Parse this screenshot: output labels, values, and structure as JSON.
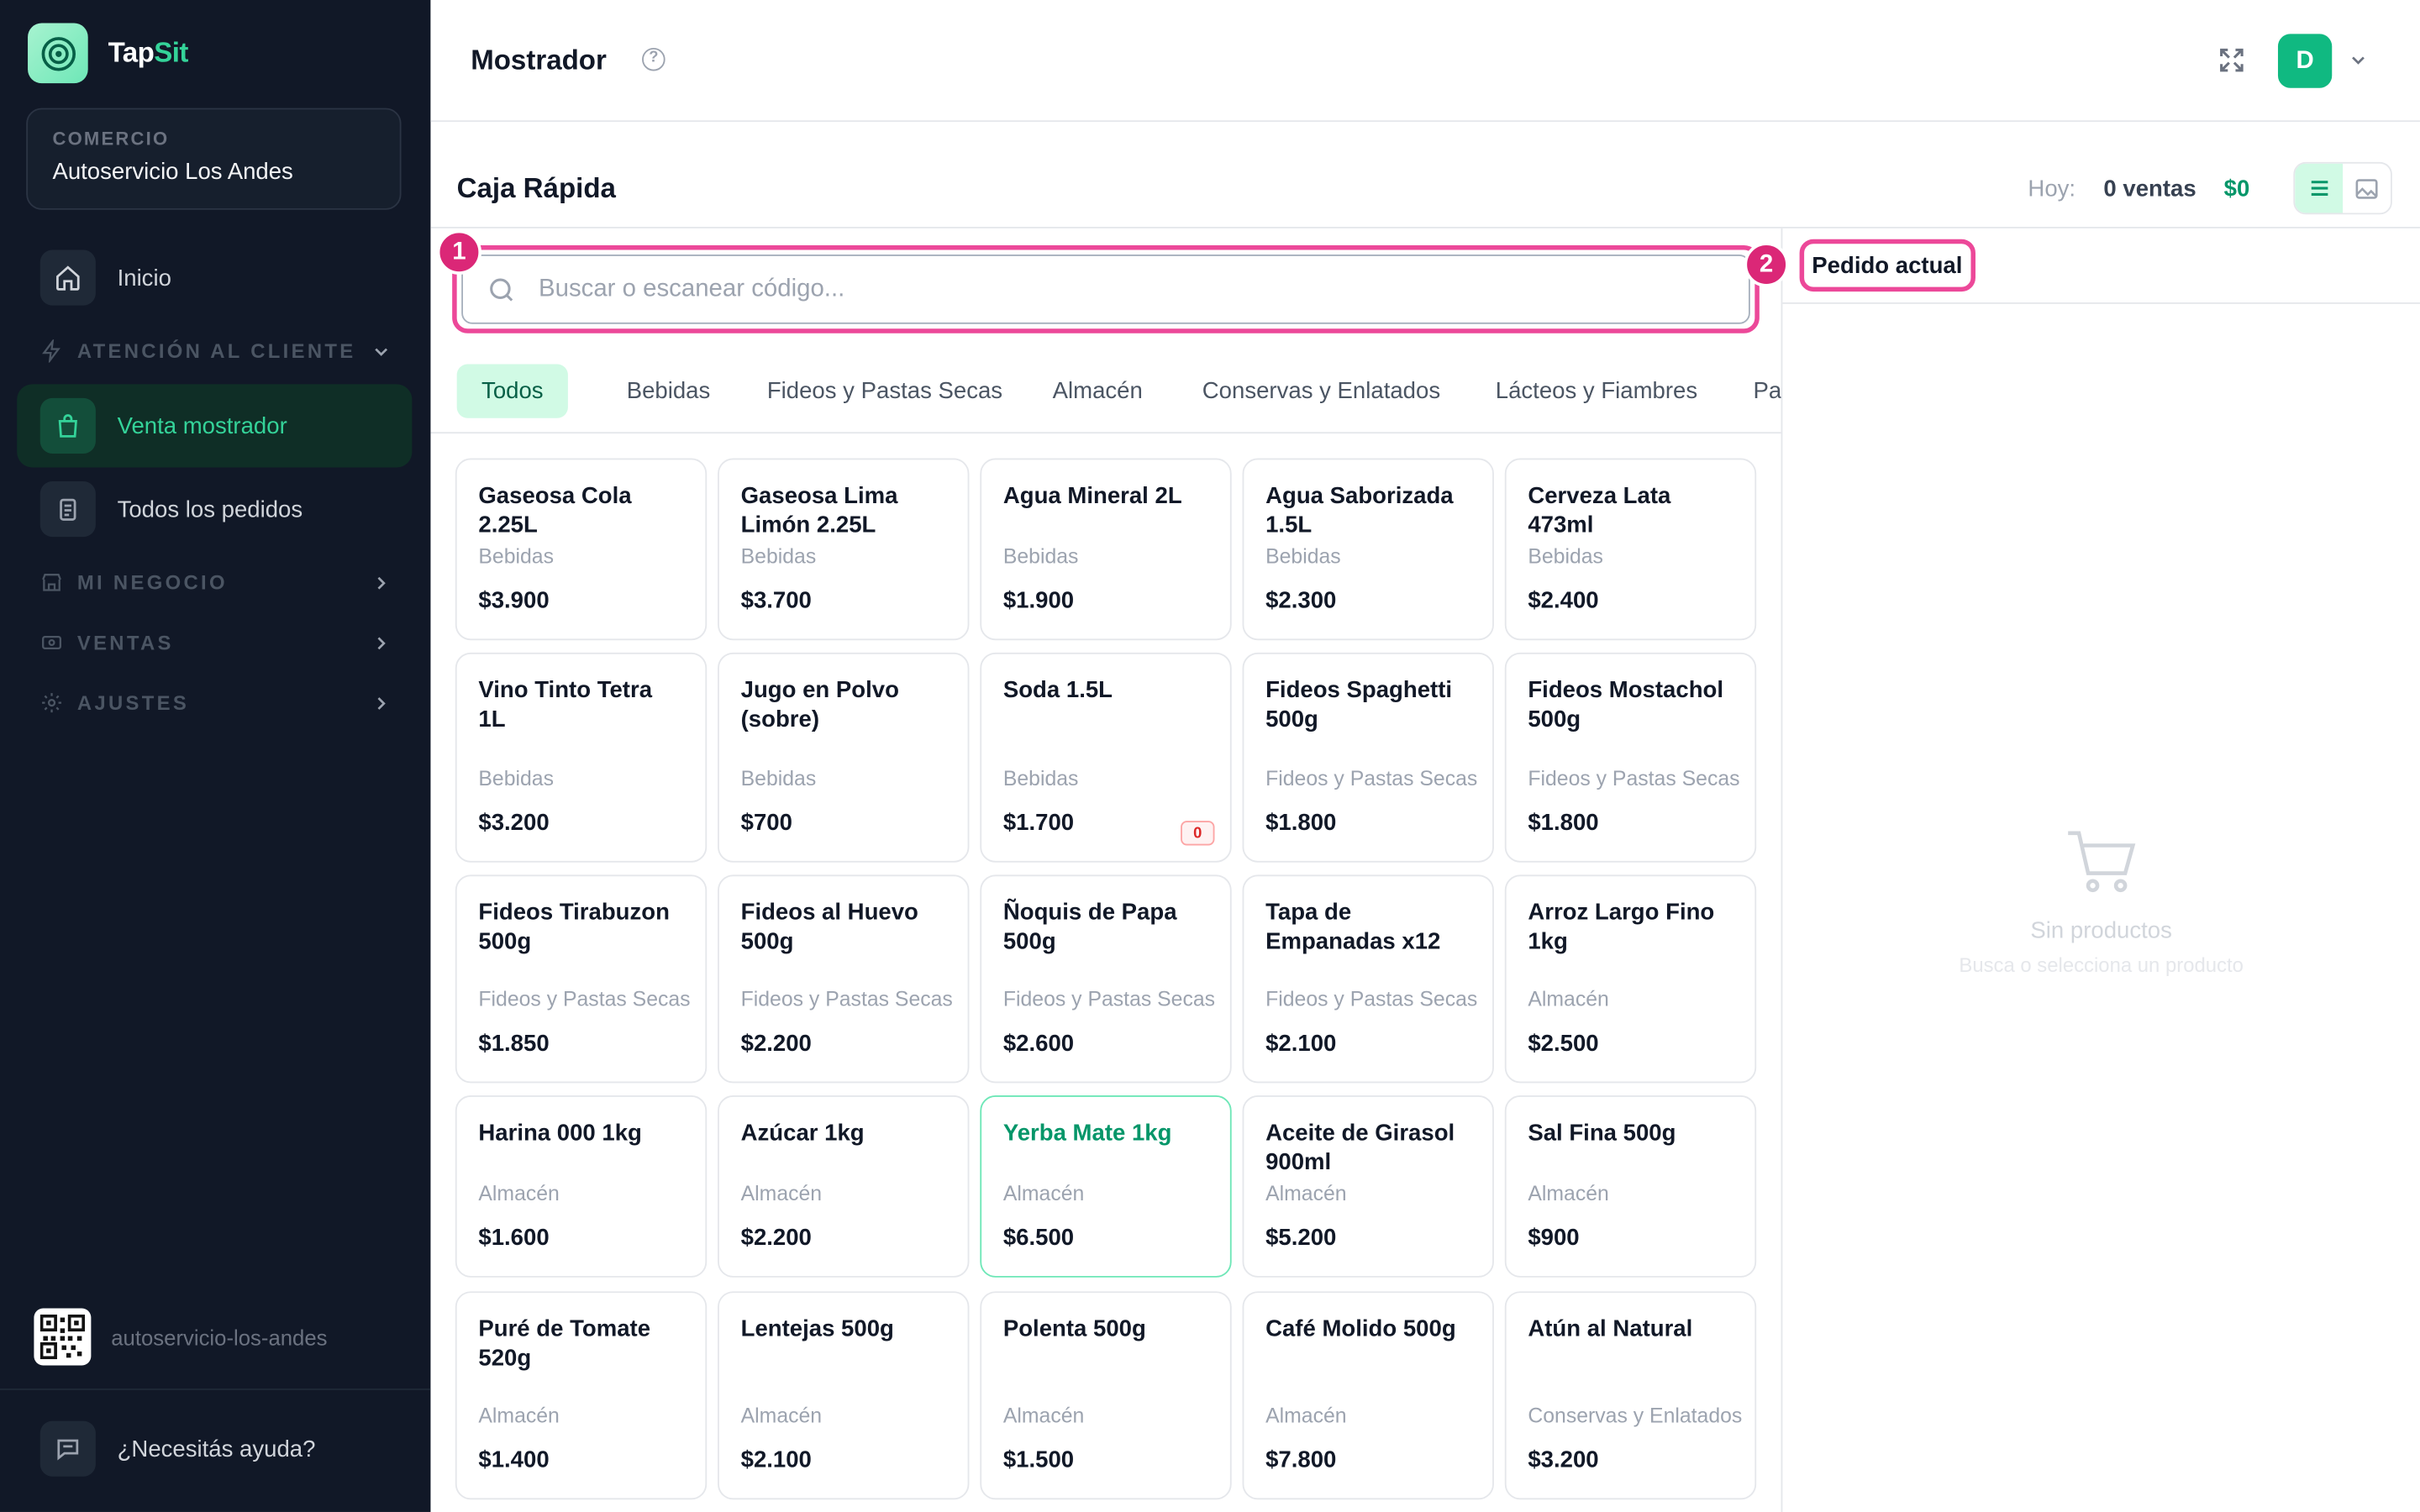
{
  "brand": {
    "name_main": "Tap",
    "name_accent": "Sit"
  },
  "store": {
    "label": "COMERCIO",
    "name": "Autoservicio Los Andes"
  },
  "sidebar": {
    "home": "Inicio",
    "sections": [
      {
        "label": "ATENCIÓN AL CLIENTE",
        "icon": "bolt-icon",
        "expanded": true
      },
      {
        "label": "MI NEGOCIO",
        "icon": "store-icon",
        "expanded": false
      },
      {
        "label": "VENTAS",
        "icon": "cash-icon",
        "expanded": false
      },
      {
        "label": "AJUSTES",
        "icon": "gear-icon",
        "expanded": false
      }
    ],
    "items": [
      {
        "label": "Venta mostrador",
        "icon": "shopping-bag-icon",
        "active": true
      },
      {
        "label": "Todos los pedidos",
        "icon": "clipboard-icon",
        "active": false
      }
    ],
    "slug": "autoservicio-los-andes",
    "help": "¿Necesitás ayuda?"
  },
  "topbar": {
    "title": "Mostrador",
    "avatar_initial": "D"
  },
  "caja": {
    "title": "Caja Rápida",
    "today_label": "Hoy:",
    "today_sales": "0 ventas",
    "today_amount": "$0"
  },
  "search": {
    "placeholder": "Buscar o escanear código...",
    "value": ""
  },
  "markers": {
    "search": "1",
    "order": "2"
  },
  "categories": [
    "Todos",
    "Bebidas",
    "Fideos y Pastas Secas",
    "Almacén",
    "Conservas y Enlatados",
    "Lácteos y Fiambres",
    "Panif"
  ],
  "products": [
    {
      "name": "Gaseosa Cola 2.25L",
      "category": "Bebidas",
      "price": "$3.900"
    },
    {
      "name": "Gaseosa Lima Limón 2.25L",
      "category": "Bebidas",
      "price": "$3.700"
    },
    {
      "name": "Agua Mineral 2L",
      "category": "Bebidas",
      "price": "$1.900"
    },
    {
      "name": "Agua Saborizada 1.5L",
      "category": "Bebidas",
      "price": "$2.300"
    },
    {
      "name": "Cerveza Lata 473ml",
      "category": "Bebidas",
      "price": "$2.400"
    },
    {
      "name": "Vino Tinto Tetra 1L",
      "category": "Bebidas",
      "price": "$3.200"
    },
    {
      "name": "Jugo en Polvo (sobre)",
      "category": "Bebidas",
      "price": "$700"
    },
    {
      "name": "Soda 1.5L",
      "category": "Bebidas",
      "price": "$1.700",
      "stock": "0"
    },
    {
      "name": "Fideos Spaghetti 500g",
      "category": "Fideos y Pastas Secas",
      "price": "$1.800"
    },
    {
      "name": "Fideos Mostachol 500g",
      "category": "Fideos y Pastas Secas",
      "price": "$1.800"
    },
    {
      "name": "Fideos Tirabuzon 500g",
      "category": "Fideos y Pastas Secas",
      "price": "$1.850"
    },
    {
      "name": "Fideos al Huevo 500g",
      "category": "Fideos y Pastas Secas",
      "price": "$2.200"
    },
    {
      "name": "Ñoquis de Papa 500g",
      "category": "Fideos y Pastas Secas",
      "price": "$2.600"
    },
    {
      "name": "Tapa de Empanadas x12",
      "category": "Fideos y Pastas Secas",
      "price": "$2.100"
    },
    {
      "name": "Arroz Largo Fino 1kg",
      "category": "Almacén",
      "price": "$2.500"
    },
    {
      "name": "Harina 000 1kg",
      "category": "Almacén",
      "price": "$1.600"
    },
    {
      "name": "Azúcar 1kg",
      "category": "Almacén",
      "price": "$2.200"
    },
    {
      "name": "Yerba Mate 1kg",
      "category": "Almacén",
      "price": "$6.500",
      "selected": true
    },
    {
      "name": "Aceite de Girasol 900ml",
      "category": "Almacén",
      "price": "$5.200"
    },
    {
      "name": "Sal Fina 500g",
      "category": "Almacén",
      "price": "$900"
    },
    {
      "name": "Puré de Tomate 520g",
      "category": "Almacén",
      "price": "$1.400"
    },
    {
      "name": "Lentejas 500g",
      "category": "Almacén",
      "price": "$2.100"
    },
    {
      "name": "Polenta 500g",
      "category": "Almacén",
      "price": "$1.500"
    },
    {
      "name": "Café Molido 500g",
      "category": "Almacén",
      "price": "$7.800"
    },
    {
      "name": "Atún al Natural",
      "category": "Conservas y Enlatados",
      "price": "$3.200"
    }
  ],
  "order": {
    "tab": "Pedido actual",
    "empty_title": "Sin productos",
    "empty_subtitle": "Busca o selecciona un producto"
  },
  "colors": {
    "accent": "#10b981",
    "sidebar_bg": "#111827",
    "highlight": "#ec4899"
  }
}
